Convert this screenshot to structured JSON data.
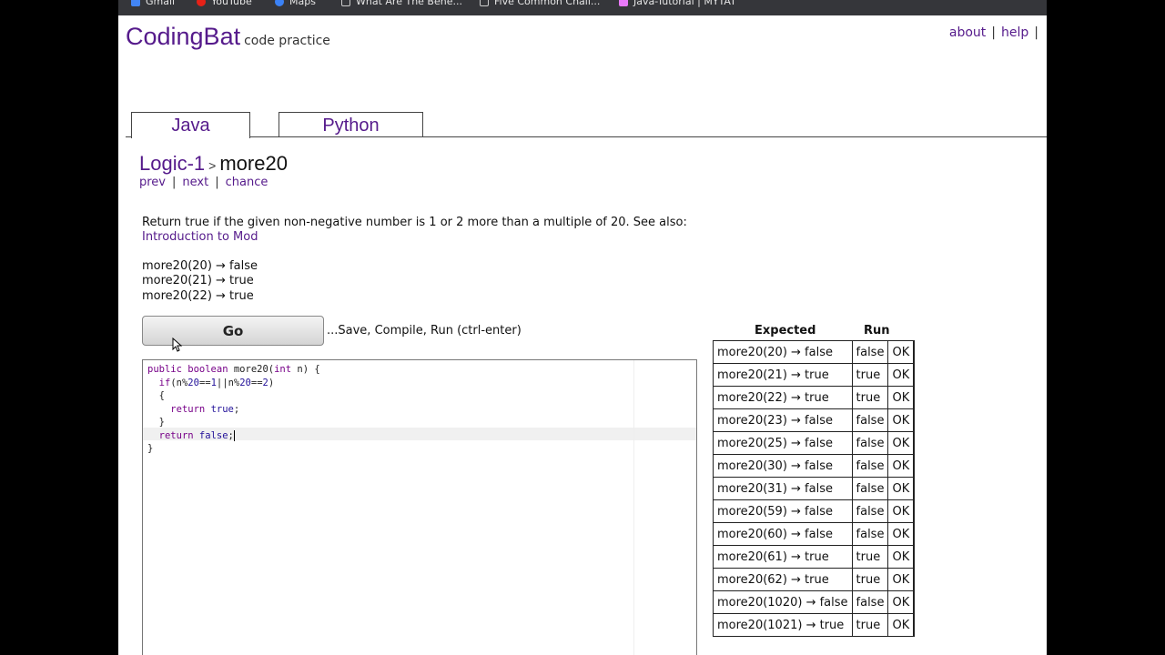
{
  "browser": {
    "bookmarks": [
      "Gmail",
      "YouTube",
      "Maps",
      "What Are The Bene...",
      "Five Common Chall...",
      "Java-Tutorial | MYTAT"
    ]
  },
  "header": {
    "brand": "CodingBat",
    "tagline": "code practice",
    "links": [
      "about",
      "help"
    ],
    "trailing_sep": "|"
  },
  "tabs": [
    {
      "label": "Java",
      "active": true
    },
    {
      "label": "Python",
      "active": false
    }
  ],
  "problem": {
    "category": "Logic-1",
    "crumb_sep": ">",
    "name": "more20",
    "nav": [
      "prev",
      "next",
      "chance"
    ],
    "description": "Return true if the given non-negative number is 1 or 2 more than a multiple of 20. See also:",
    "see_also_link": "Introduction to Mod",
    "examples": [
      "more20(20) → false",
      "more20(21) → true",
      "more20(22) → true"
    ]
  },
  "editor": {
    "go_label": "Go",
    "go_hint": "...Save, Compile, Run (ctrl-enter)",
    "lines": [
      "public boolean more20(int n) {",
      "  if(n%20==1||n%20==2)",
      "  {",
      "    return true;",
      "  }",
      "  return false;",
      "}"
    ]
  },
  "results": {
    "col_expected": "Expected",
    "col_run": "Run",
    "ok_color": "#19b518",
    "rows": [
      {
        "expected": "more20(20) → false",
        "run": "false",
        "status": "OK"
      },
      {
        "expected": "more20(21) → true",
        "run": "true",
        "status": "OK"
      },
      {
        "expected": "more20(22) → true",
        "run": "true",
        "status": "OK"
      },
      {
        "expected": "more20(23) → false",
        "run": "false",
        "status": "OK"
      },
      {
        "expected": "more20(25) → false",
        "run": "false",
        "status": "OK"
      },
      {
        "expected": "more20(30) → false",
        "run": "false",
        "status": "OK"
      },
      {
        "expected": "more20(31) → false",
        "run": "false",
        "status": "OK"
      },
      {
        "expected": "more20(59) → false",
        "run": "false",
        "status": "OK"
      },
      {
        "expected": "more20(60) → false",
        "run": "false",
        "status": "OK"
      },
      {
        "expected": "more20(61) → true",
        "run": "true",
        "status": "OK"
      },
      {
        "expected": "more20(62) → true",
        "run": "true",
        "status": "OK"
      },
      {
        "expected": "more20(1020) → false",
        "run": "false",
        "status": "OK"
      },
      {
        "expected": "more20(1021) → true",
        "run": "true",
        "status": "OK"
      }
    ]
  }
}
